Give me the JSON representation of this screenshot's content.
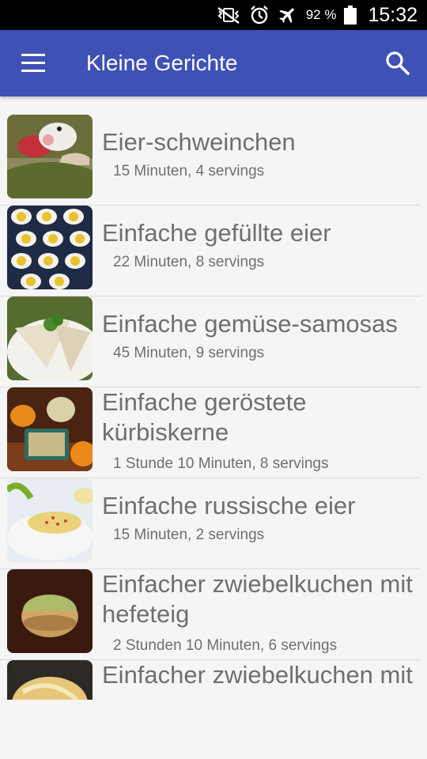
{
  "status": {
    "battery": "92 %",
    "time": "15:32"
  },
  "app": {
    "title": "Kleine Gerichte"
  },
  "recipes": [
    {
      "title": "Eier-schweinchen",
      "meta": "15 Minuten, 4 servings",
      "image": "pig-egg"
    },
    {
      "title": "Einfache gefüllte eier",
      "meta": "22 Minuten, 8 servings",
      "image": "deviled-eggs"
    },
    {
      "title": "Einfache gemüse-samosas",
      "meta": "45 Minuten, 9 servings",
      "image": "samosas"
    },
    {
      "title": "Einfache geröstete kürbiskerne",
      "meta": "1 Stunde 10 Minuten, 8 servings",
      "image": "pumpkin-seeds"
    },
    {
      "title": "Einfache russische eier",
      "meta": "15 Minuten, 2 servings",
      "image": "russian-eggs"
    },
    {
      "title": "Einfacher zwiebelkuchen mit hefeteig",
      "meta": "2 Stunden 10 Minuten, 6 servings",
      "image": "onion-cake"
    },
    {
      "title": "Einfacher zwiebelkuchen mit ...",
      "meta": "",
      "image": "onion-cake-2"
    }
  ]
}
